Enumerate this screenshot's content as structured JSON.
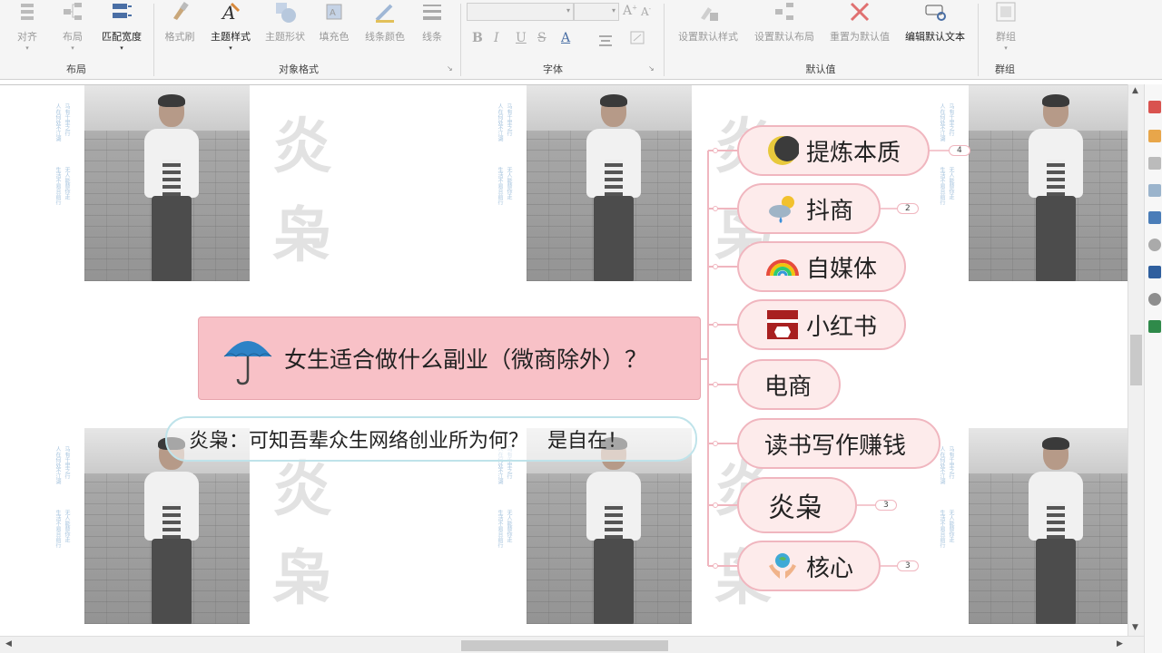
{
  "ribbon": {
    "groups": {
      "layout": "布局",
      "object_format": "对象格式",
      "font": "字体",
      "defaults": "默认值",
      "group": "群组"
    },
    "buttons": {
      "align": "对齐",
      "layout": "布局",
      "fit_width": "匹配宽度",
      "format_painter": "格式刷",
      "theme_style": "主题样式",
      "theme_shape": "主题形状",
      "fill_color": "填充色",
      "line_color": "线条颜色",
      "line": "线条",
      "set_default_style": "设置默认样式",
      "set_default_layout": "设置默认布局",
      "reset_default": "重置为默认值",
      "edit_default_text": "编辑默认文本",
      "group": "群组"
    },
    "font_format": [
      "B",
      "I",
      "U",
      "S",
      "A"
    ]
  },
  "map": {
    "central": "女生适合做什么副业（微商除外）？",
    "callout": "炎枭：可知吾辈众生网络创业所为何？   是自在！",
    "branches": [
      {
        "label": "提炼本质",
        "icon": "moon-icon",
        "badge": "4"
      },
      {
        "label": "抖商",
        "icon": "weather-icon",
        "badge": "2"
      },
      {
        "label": "自媒体",
        "icon": "rainbow-icon",
        "badge": ""
      },
      {
        "label": "小红书",
        "icon": "xiaohongshu-icon",
        "badge": ""
      },
      {
        "label": "电商",
        "icon": "",
        "badge": ""
      },
      {
        "label": "读书写作赚钱",
        "icon": "",
        "badge": ""
      },
      {
        "label": "炎枭",
        "icon": "",
        "badge": "3"
      },
      {
        "label": "核心",
        "icon": "globe-hands-icon",
        "badge": "3"
      }
    ]
  },
  "wallpaper": {
    "watermark_top": "炎",
    "watermark_bottom": "枭",
    "side_text": [
      "人在何处不江湖",
      "生活不易且前行",
      "马有千里之行",
      "无人能替你走"
    ]
  },
  "colors": {
    "node_fill": "#fdebeb",
    "node_border": "#f0b6bf",
    "central_fill": "#f8c1c7",
    "connector": "#f0b6bf",
    "callout_border": "#bfe3ea"
  }
}
